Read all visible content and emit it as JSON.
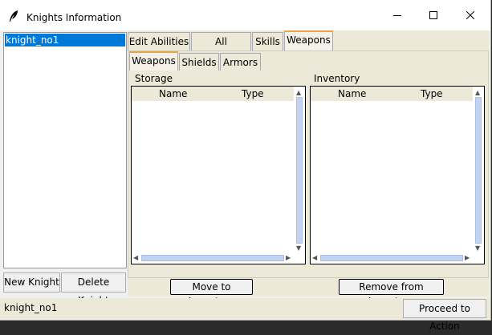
{
  "window": {
    "title": "Knights Information",
    "icon": "feather-icon"
  },
  "knights": {
    "items": [
      "knight_no1"
    ],
    "selected": "knight_no1",
    "new_button": "New Knight",
    "delete_button": "Delete Knight"
  },
  "status": {
    "text": "knight_no1",
    "proceed_button": "Proceed to Action"
  },
  "main_tabs": [
    {
      "label": "Edit Abilities"
    },
    {
      "label": "All Statistics"
    },
    {
      "label": "Skills"
    },
    {
      "label": "Weapons",
      "active": true
    }
  ],
  "sub_tabs": [
    {
      "label": "Weapons",
      "active": true
    },
    {
      "label": "Shields"
    },
    {
      "label": "Armors"
    }
  ],
  "storage": {
    "label": "Storage",
    "columns": [
      "Name",
      "Type"
    ],
    "rows": []
  },
  "inventory": {
    "label": "Inventory",
    "columns": [
      "Name",
      "Type"
    ],
    "rows": []
  },
  "actions": {
    "move": "Move to Inventory",
    "remove": "Remove from Inventory"
  }
}
